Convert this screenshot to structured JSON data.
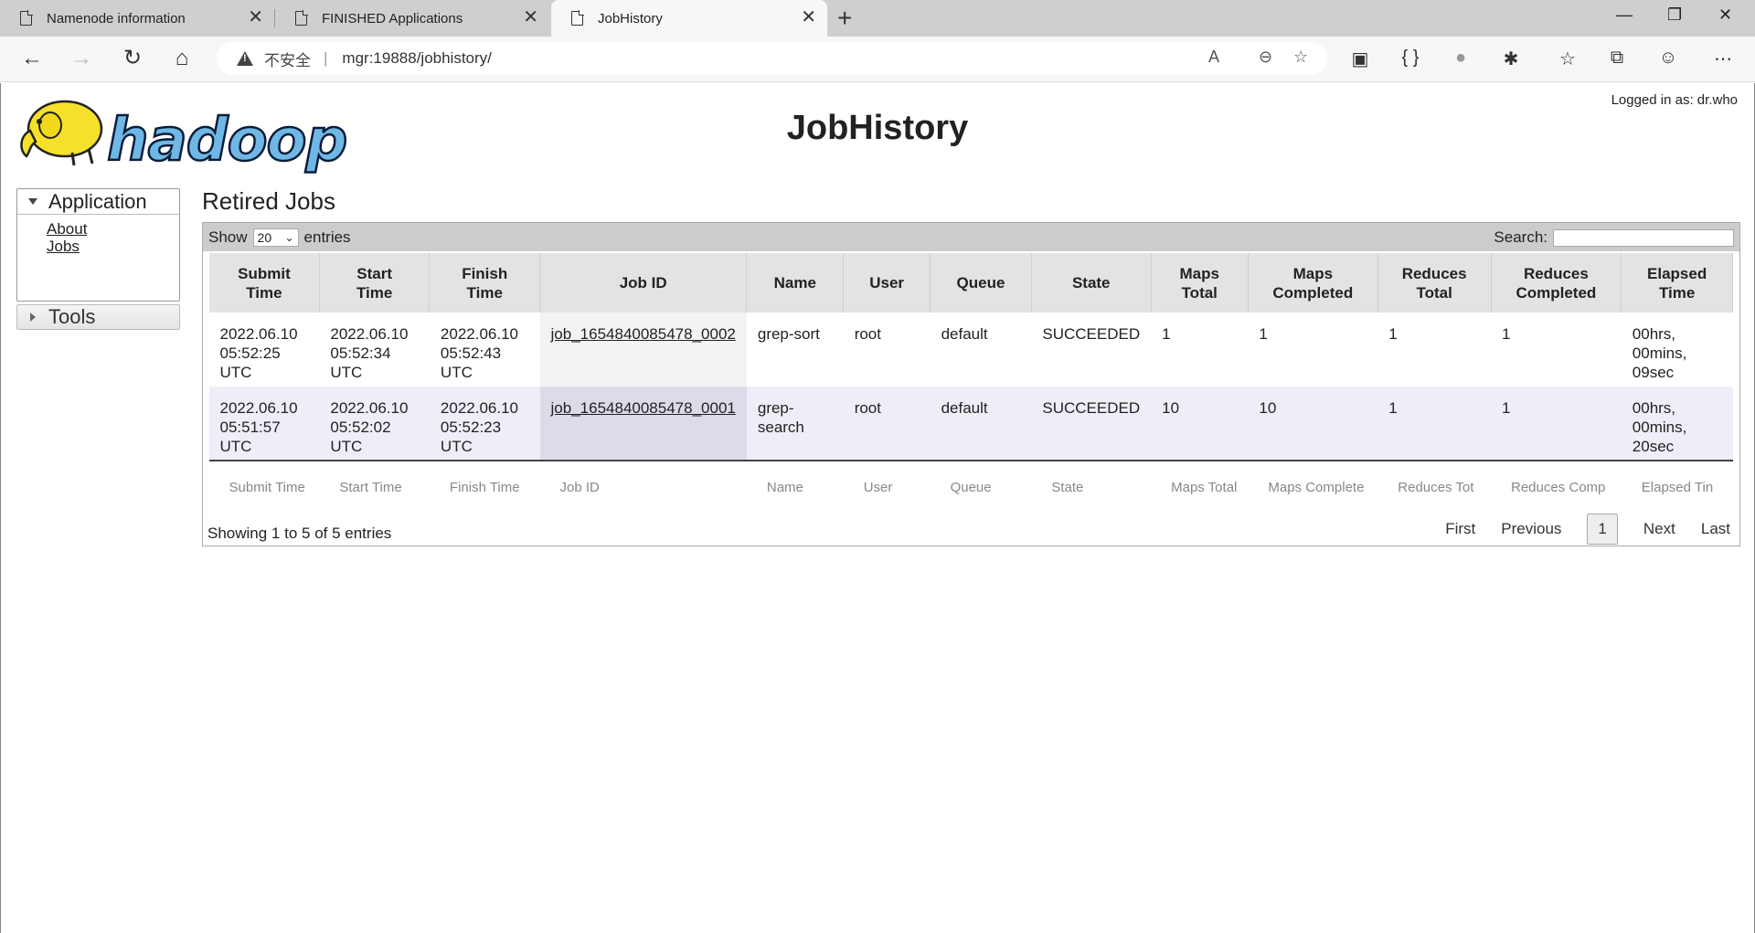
{
  "browser": {
    "tabs": [
      {
        "title": "Namenode information"
      },
      {
        "title": "FINISHED Applications"
      },
      {
        "title": "JobHistory"
      }
    ],
    "insecure_label": "不安全",
    "url": "mgr:19888/jobhistory/"
  },
  "header": {
    "logo_text": "hadoop",
    "title": "JobHistory",
    "logged_in": "Logged in as: dr.who"
  },
  "sidebar": {
    "application_label": "Application",
    "links": [
      {
        "label": "About"
      },
      {
        "label": "Jobs"
      }
    ],
    "tools_label": "Tools"
  },
  "main": {
    "section_title": "Retired Jobs",
    "show_label": "Show",
    "show_value": "20",
    "entries_label": "entries",
    "search_label": "Search:",
    "columns": [
      [
        "Submit",
        "Time"
      ],
      [
        "Start",
        "Time"
      ],
      [
        "Finish",
        "Time"
      ],
      [
        "Job ID"
      ],
      [
        "Name"
      ],
      [
        "User"
      ],
      [
        "Queue"
      ],
      [
        "State"
      ],
      [
        "Maps",
        "Total"
      ],
      [
        "Maps",
        "Completed"
      ],
      [
        "Reduces",
        "Total"
      ],
      [
        "Reduces",
        "Completed"
      ],
      [
        "Elapsed",
        "Time"
      ]
    ],
    "rows": [
      {
        "submit": [
          "2022.06.10",
          "05:52:25",
          "UTC"
        ],
        "start": [
          "2022.06.10",
          "05:52:34",
          "UTC"
        ],
        "finish": [
          "2022.06.10",
          "05:52:43",
          "UTC"
        ],
        "job_id": "job_1654840085478_0002",
        "name": [
          "grep-sort"
        ],
        "user": "root",
        "queue": "default",
        "state": "SUCCEEDED",
        "maps_total": "1",
        "maps_completed": "1",
        "reduces_total": "1",
        "reduces_completed": "1",
        "elapsed": [
          "00hrs,",
          "00mins,",
          "09sec"
        ]
      },
      {
        "submit": [
          "2022.06.10",
          "05:51:57",
          "UTC"
        ],
        "start": [
          "2022.06.10",
          "05:52:02",
          "UTC"
        ],
        "finish": [
          "2022.06.10",
          "05:52:23",
          "UTC"
        ],
        "job_id": "job_1654840085478_0001",
        "name": [
          "grep-",
          "search"
        ],
        "user": "root",
        "queue": "default",
        "state": "SUCCEEDED",
        "maps_total": "10",
        "maps_completed": "10",
        "reduces_total": "1",
        "reduces_completed": "1",
        "elapsed": [
          "00hrs,",
          "00mins,",
          "20sec"
        ]
      }
    ],
    "footer_filters": [
      "Submit Time",
      "Start Time",
      "Finish Time",
      "Job ID",
      "Name",
      "User",
      "Queue",
      "State",
      "Maps Total",
      "Maps Complete",
      "Reduces Tot",
      "Reduces Comp",
      "Elapsed Tin"
    ],
    "showing_text": "Showing 1 to 5 of 5 entries",
    "pager": {
      "first": "First",
      "previous": "Previous",
      "current": "1",
      "next": "Next",
      "last": "Last"
    }
  }
}
